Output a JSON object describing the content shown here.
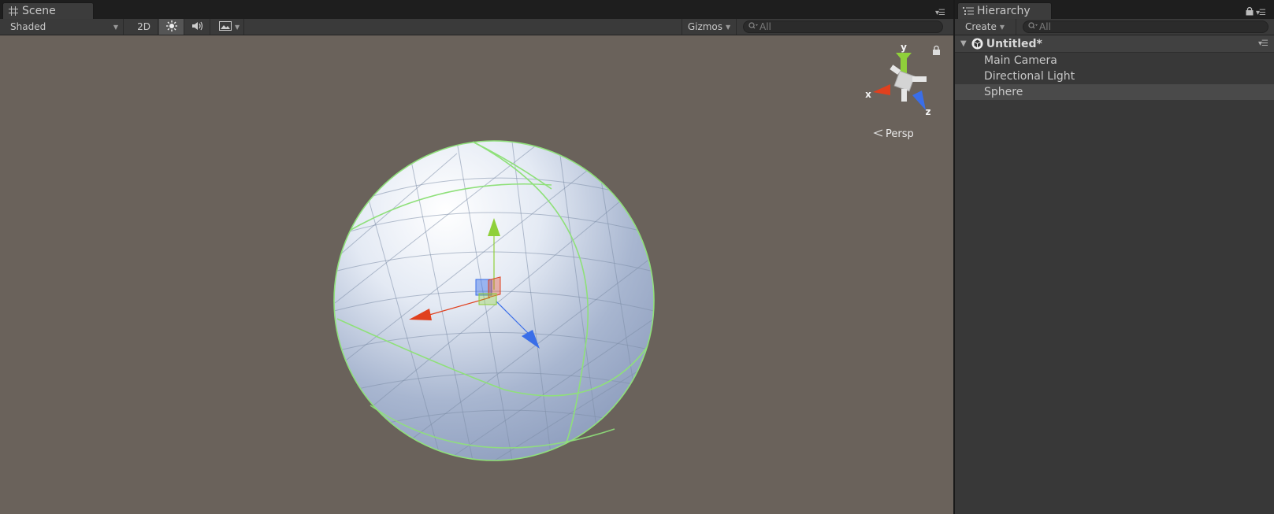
{
  "scene": {
    "tab_label": "Scene",
    "shading_mode": "Shaded",
    "mode_2d": "2D",
    "gizmos_label": "Gizmos",
    "search_placeholder": "All",
    "projection_label": "Persp",
    "axis_labels": {
      "x": "x",
      "y": "y",
      "z": "z"
    },
    "colors": {
      "viewport_bg": "#6a625b",
      "axis_x": "#e0401e",
      "axis_y": "#8fd03a",
      "axis_z": "#3a6ee8",
      "selection_outline": "#8fe07a"
    }
  },
  "hierarchy": {
    "tab_label": "Hierarchy",
    "create_label": "Create",
    "search_placeholder": "All",
    "scene_title": "Untitled*",
    "items": [
      {
        "label": "Main Camera",
        "selected": false
      },
      {
        "label": "Directional Light",
        "selected": false
      },
      {
        "label": "Sphere",
        "selected": true
      }
    ]
  }
}
